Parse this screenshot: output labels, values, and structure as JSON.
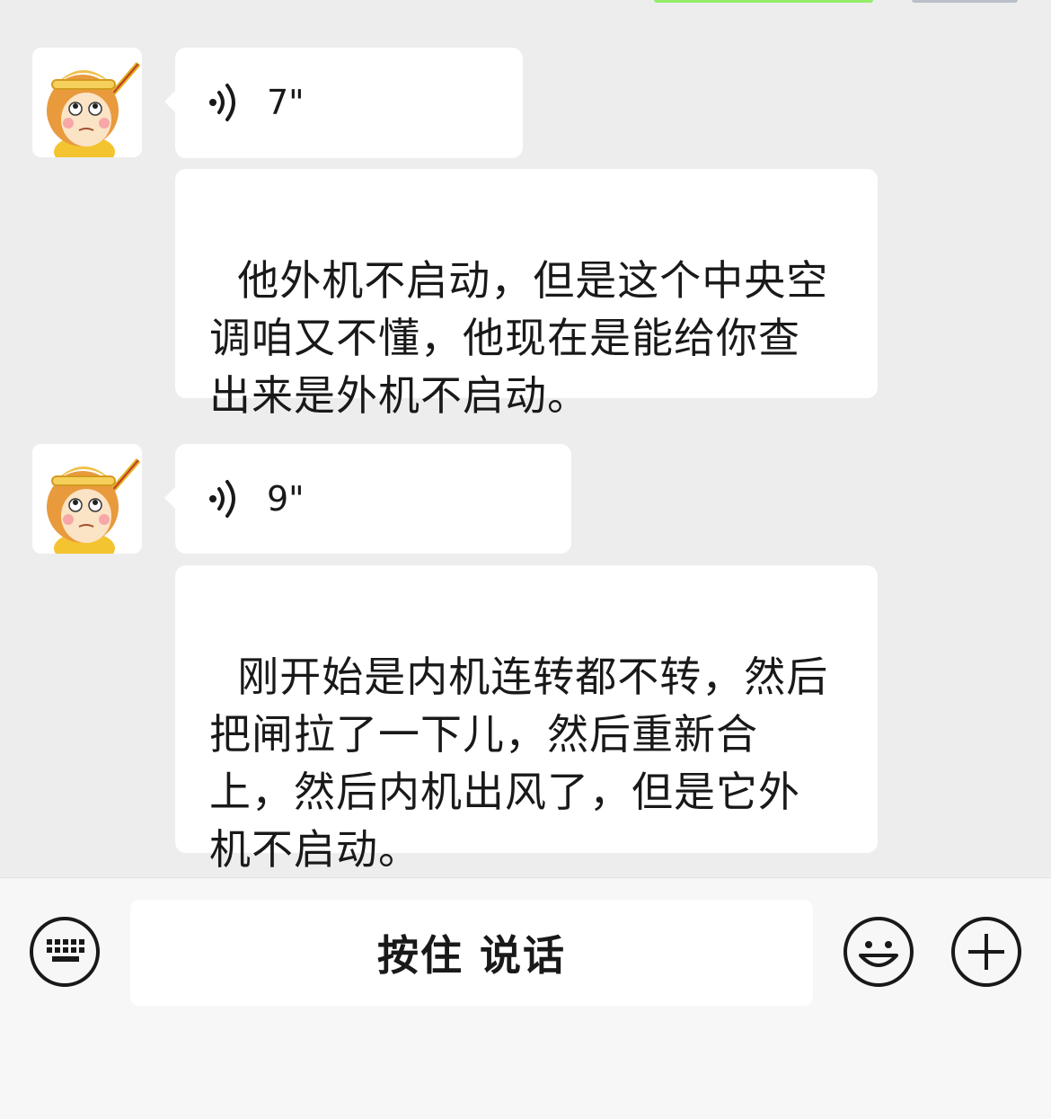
{
  "messages": [
    {
      "type": "voice",
      "duration": "7\""
    },
    {
      "type": "text",
      "text": "他外机不启动，但是这个中央空\n调咱又不懂，他现在是能给你查\n出来是外机不启动。"
    },
    {
      "type": "voice",
      "duration": "9\""
    },
    {
      "type": "text",
      "text": "刚开始是内机连转都不转，然后\n把闸拉了一下儿，然后重新合\n上，然后内机出风了，但是它外\n机不启动。"
    }
  ],
  "input_bar": {
    "talk_label": "按住 说话",
    "keyboard_icon": "keyboard-icon",
    "emoji_icon": "emoji-icon",
    "plus_icon": "plus-icon"
  },
  "colors": {
    "background": "#ededed",
    "bubble": "#ffffff",
    "input_bar": "#f7f7f7"
  }
}
